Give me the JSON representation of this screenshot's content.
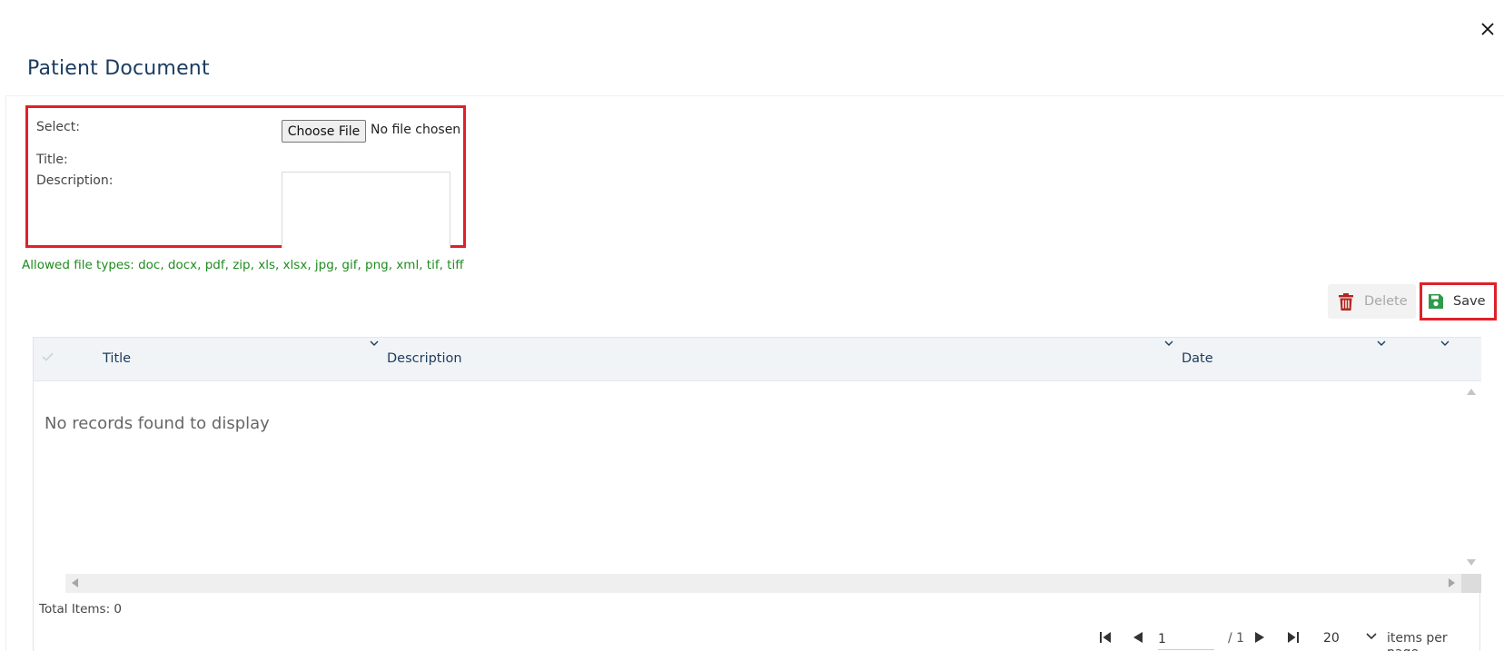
{
  "dialog": {
    "title": "Patient Document",
    "close_icon": "close-icon"
  },
  "form": {
    "select_label": "Select:",
    "choose_file_label": "Choose File",
    "file_status": "No file chosen",
    "title_label": "Title:",
    "description_label": "Description:",
    "description_value": ""
  },
  "allowed_types": "Allowed file types: doc, docx, pdf, zip, xls, xlsx, jpg, gif, png, xml, tif, tiff",
  "toolbar": {
    "delete_label": "Delete",
    "save_label": "Save",
    "delete_color": "#b3261e",
    "save_color": "#2e9a4a"
  },
  "grid": {
    "columns": [
      {
        "label": "Title"
      },
      {
        "label": "Description"
      },
      {
        "label": "Date"
      }
    ],
    "empty_message": "No records found to display",
    "total_items": "Total Items: 0"
  },
  "pager": {
    "current_page": "1",
    "total_pages": "/ 1",
    "page_size": "20",
    "page_size_label": "items per page"
  }
}
